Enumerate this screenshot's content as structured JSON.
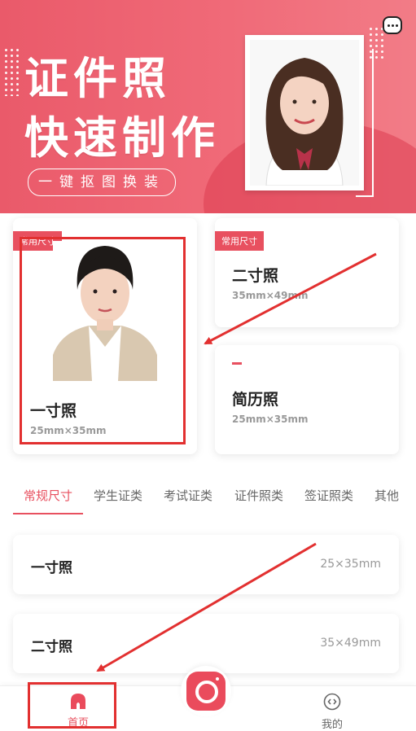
{
  "banner": {
    "title_line1": "证件照",
    "title_line2": "快速制作",
    "subtitle": "一键抠图换装"
  },
  "featured": [
    {
      "tag": "常用尺寸",
      "title": "一寸照",
      "size": "25mm×35mm"
    },
    {
      "tag": "常用尺寸",
      "title": "二寸照",
      "size": "35mm×49mm"
    },
    {
      "title": "简历照",
      "size": "25mm×35mm"
    }
  ],
  "tabs": [
    {
      "label": "常规尺寸",
      "active": true
    },
    {
      "label": "学生证类"
    },
    {
      "label": "考试证类"
    },
    {
      "label": "证件照类"
    },
    {
      "label": "签证照类"
    },
    {
      "label": "其他"
    }
  ],
  "list": [
    {
      "name": "一寸照",
      "size": "25×35mm"
    },
    {
      "name": "二寸照",
      "size": "35×49mm"
    }
  ],
  "bottom_nav": {
    "home": "首页",
    "mine": "我的"
  },
  "colors": {
    "accent": "#e8505f",
    "annotation_red": "#e23030"
  },
  "icons": [
    "more-icon",
    "home-icon",
    "camera-icon",
    "profile-icon"
  ]
}
